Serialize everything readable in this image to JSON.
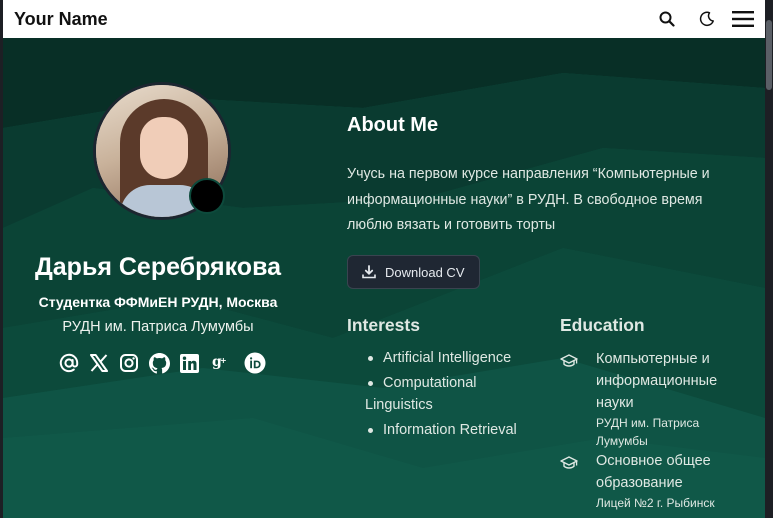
{
  "navbar": {
    "brand": "Your Name",
    "icons": [
      "search-icon",
      "moon-icon",
      "hamburger-menu-icon"
    ]
  },
  "profile": {
    "name": "Дарья Серебрякова",
    "role": "Студентка ФФМиЕН РУДН, Москва",
    "organization": "РУДН им. Патриса Лумумбы",
    "socials": [
      "at-sign-icon",
      "x-twitter-icon",
      "instagram-icon",
      "github-icon",
      "linkedin-icon",
      "google-scholar-icon",
      "orcid-icon"
    ]
  },
  "about": {
    "title": "About Me",
    "text": "Учусь на первом курсе направления “Компьютерные и информационные науки” в РУДН. В свободное время люблю вязать и готовить торты",
    "cv_button": "Download CV"
  },
  "interests": {
    "title": "Interests",
    "items": [
      "Artificial Intelligence",
      "Computational",
      "Linguistics",
      "Information Retrieval"
    ]
  },
  "education": {
    "title": "Education",
    "items": [
      {
        "degree": "Компьютерные и информационные науки",
        "school": "РУДН им. Патриса Лумумбы"
      },
      {
        "degree": "Основное общее образование",
        "school": "Лицей №2 г. Рыбинск"
      }
    ]
  },
  "colors": {
    "hero_bg": "#0d4a3c",
    "hero_dark": "#093a2f",
    "navbar_bg": "#ffffff",
    "button_bg": "#1f2733"
  }
}
